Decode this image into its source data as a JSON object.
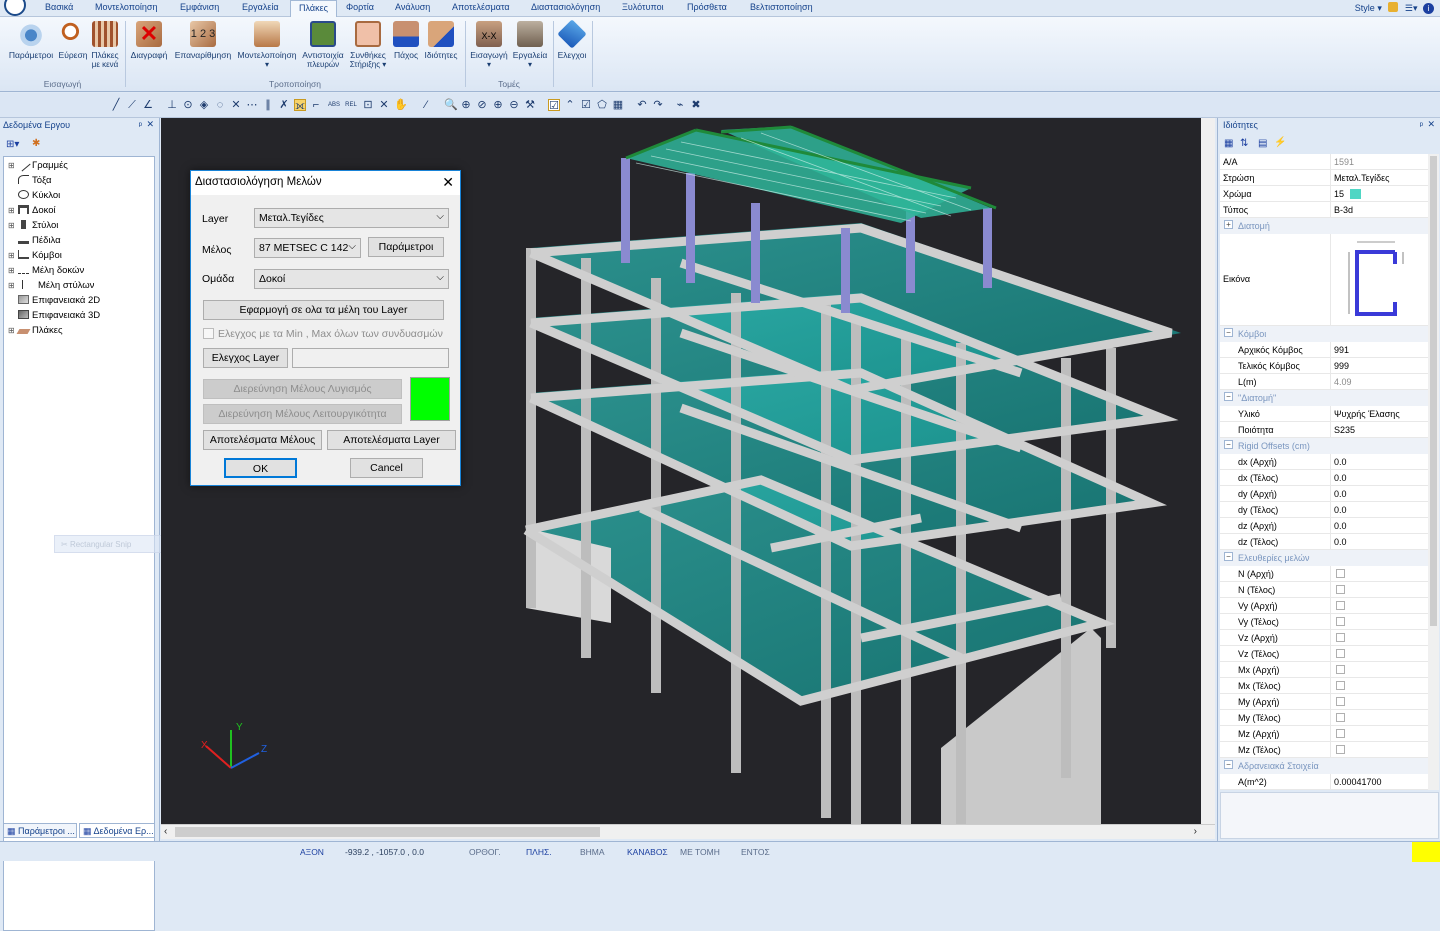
{
  "menu": {
    "tabs": [
      "Βασικά",
      "Μοντελοποίηση",
      "Εμφάνιση",
      "Εργαλεία",
      "Πλάκες",
      "Φορτία",
      "Ανάλυση",
      "Αποτελέσματα",
      "Διαστασιολόγηση",
      "Ξυλότυποι",
      "Πρόσθετα",
      "Βελτιστοποίηση"
    ],
    "active_index": 4,
    "style_label": "Style"
  },
  "ribbon": {
    "buttons": [
      {
        "label": "Παράμετροι",
        "icon": "parameters-icon"
      },
      {
        "label": "Εύρεση",
        "icon": "find-icon"
      },
      {
        "label": "Πλάκες",
        "sub": "με κενά",
        "icon": "slab-openings-icon"
      },
      {
        "label": "Διαγραφή",
        "icon": "delete-icon"
      },
      {
        "label": "Επαναρίθμηση",
        "icon": "renumber-icon"
      },
      {
        "label": "Μοντελοποίηση",
        "sub": "▾",
        "icon": "modeling-icon"
      },
      {
        "label": "Αντιστοιχία",
        "sub": "πλευρών",
        "icon": "edge-match-icon"
      },
      {
        "label": "Συνθήκες",
        "sub": "Στήριξης ▾",
        "icon": "support-conditions-icon"
      },
      {
        "label": "Πάχος",
        "icon": "thickness-icon"
      },
      {
        "label": "Ιδιότητες",
        "icon": "properties-icon"
      },
      {
        "label": "Εισαγωγή",
        "sub": "▾",
        "icon": "section-insert-icon"
      },
      {
        "label": "Εργαλεία",
        "sub": "▾",
        "icon": "section-tools-icon"
      },
      {
        "label": "Ελεγχοι",
        "icon": "checks-icon"
      }
    ],
    "groups": [
      "Εισαγωγή",
      "Τροποποίηση",
      "Τομές"
    ]
  },
  "left_panel": {
    "title": "Δεδομένα Εργου",
    "tree": [
      "Γραμμές",
      "Τόξα",
      "Κύκλοι",
      "Δοκοί",
      "Στύλοι",
      "Πέδιλα",
      "Κόμβοι",
      "Μέλη δοκών",
      "Μέλη στύλων",
      "Επιφανειακά 2D",
      "Επιφανειακά 3D",
      "Πλάκες"
    ],
    "tabs": [
      "Παράμετροι ...",
      "Δεδομένα Ερ..."
    ],
    "ghost": "Rectangular Snip"
  },
  "dialog": {
    "title": "Διαστασιολόγηση Μελών",
    "layer_label": "Layer",
    "layer_value": "Μεταλ.Τεγίδες",
    "member_label": "Μέλος",
    "member_value": "87 METSEC C 142",
    "params_button": "Παράμετροι",
    "group_label": "Ομάδα",
    "group_value": "Δοκοί",
    "apply_all_button": "Εφαρμογή σε ολα τα μέλη του Layer",
    "minmax_check": "Ελεγχος με τα Min , Max όλων των συνδυασμών",
    "check_layer_button": "Ελεγχος Layer",
    "check_layer_value": "",
    "explore_calc_button": "Διερεύνηση Μέλους Λυγισμός",
    "explore_func_button": "Διερεύνηση Μέλους Λειτουργικότητα",
    "status_color": "#00ff00",
    "member_results_button": "Αποτελέσματα Μέλους",
    "layer_results_button": "Αποτελέσματα Layer",
    "ok_button": "OK",
    "cancel_button": "Cancel"
  },
  "axes": {
    "x": "X",
    "y": "Y",
    "z": "Z"
  },
  "right_panel": {
    "title": "Ιδιότητες",
    "rows": [
      {
        "k": "Α/Α",
        "v": "1591",
        "gray": true
      },
      {
        "k": "Στρώση",
        "v": "Μεταλ.Τεγίδες"
      },
      {
        "k": "Χρώμα",
        "v": "15",
        "swatch": "#4fd6c4"
      },
      {
        "k": "Τύπος",
        "v": "B-3d"
      }
    ],
    "cat_section": "Διατομή",
    "image_label": "Εικόνα",
    "cat_nodes": "Κόμβοι",
    "nodes": [
      {
        "k": "Αρχικός Κόμβος",
        "v": "991"
      },
      {
        "k": "Τελικός Κόμβος",
        "v": "999"
      },
      {
        "k": "L(m)",
        "v": "4.09",
        "gray": true
      }
    ],
    "cat_section2": "\"Διατομή\"",
    "section2": [
      {
        "k": "Υλικό",
        "v": "Ψυχρής Έλασης"
      },
      {
        "k": "Ποιότητα",
        "v": "S235"
      }
    ],
    "cat_offsets": "Rigid Offsets (cm)",
    "offsets": [
      {
        "k": "dx (Αρχή)",
        "v": "0.0"
      },
      {
        "k": "dx (Τέλος)",
        "v": "0.0"
      },
      {
        "k": "dy (Αρχή)",
        "v": "0.0"
      },
      {
        "k": "dy (Τέλος)",
        "v": "0.0"
      },
      {
        "k": "dz (Αρχή)",
        "v": "0.0"
      },
      {
        "k": "dz (Τέλος)",
        "v": "0.0"
      }
    ],
    "cat_releases": "Ελευθερίες μελών",
    "releases": [
      "N (Αρχή)",
      "N (Τέλος)",
      "Vy (Αρχή)",
      "Vy (Τέλος)",
      "Vz (Αρχή)",
      "Vz (Τέλος)",
      "Mx (Αρχή)",
      "Mx (Τέλος)",
      "My (Αρχή)",
      "My (Τέλος)",
      "Mz (Αρχή)",
      "Mz (Τέλος)"
    ],
    "cat_area": "Αδρανειακά Στοιχεία",
    "area": {
      "k": "A(m^2)",
      "v": "0.00041700"
    }
  },
  "status": {
    "items": [
      {
        "t": "ΑΞΟΝ",
        "on": true
      },
      {
        "t": "-939.2 , -1057.0 , 0.0",
        "on": false,
        "dark": true
      },
      {
        "t": "ΟΡΘΟΓ.",
        "on": false
      },
      {
        "t": "ΠΛΗΣ.",
        "on": true
      },
      {
        "t": "ΒΗΜΑ",
        "on": false
      },
      {
        "t": "ΚΑΝΑΒΟΣ",
        "on": true
      },
      {
        "t": "ΜΕ ΤΟΜΗ",
        "on": false
      },
      {
        "t": "ΕΝΤΟΣ",
        "on": false
      }
    ]
  }
}
